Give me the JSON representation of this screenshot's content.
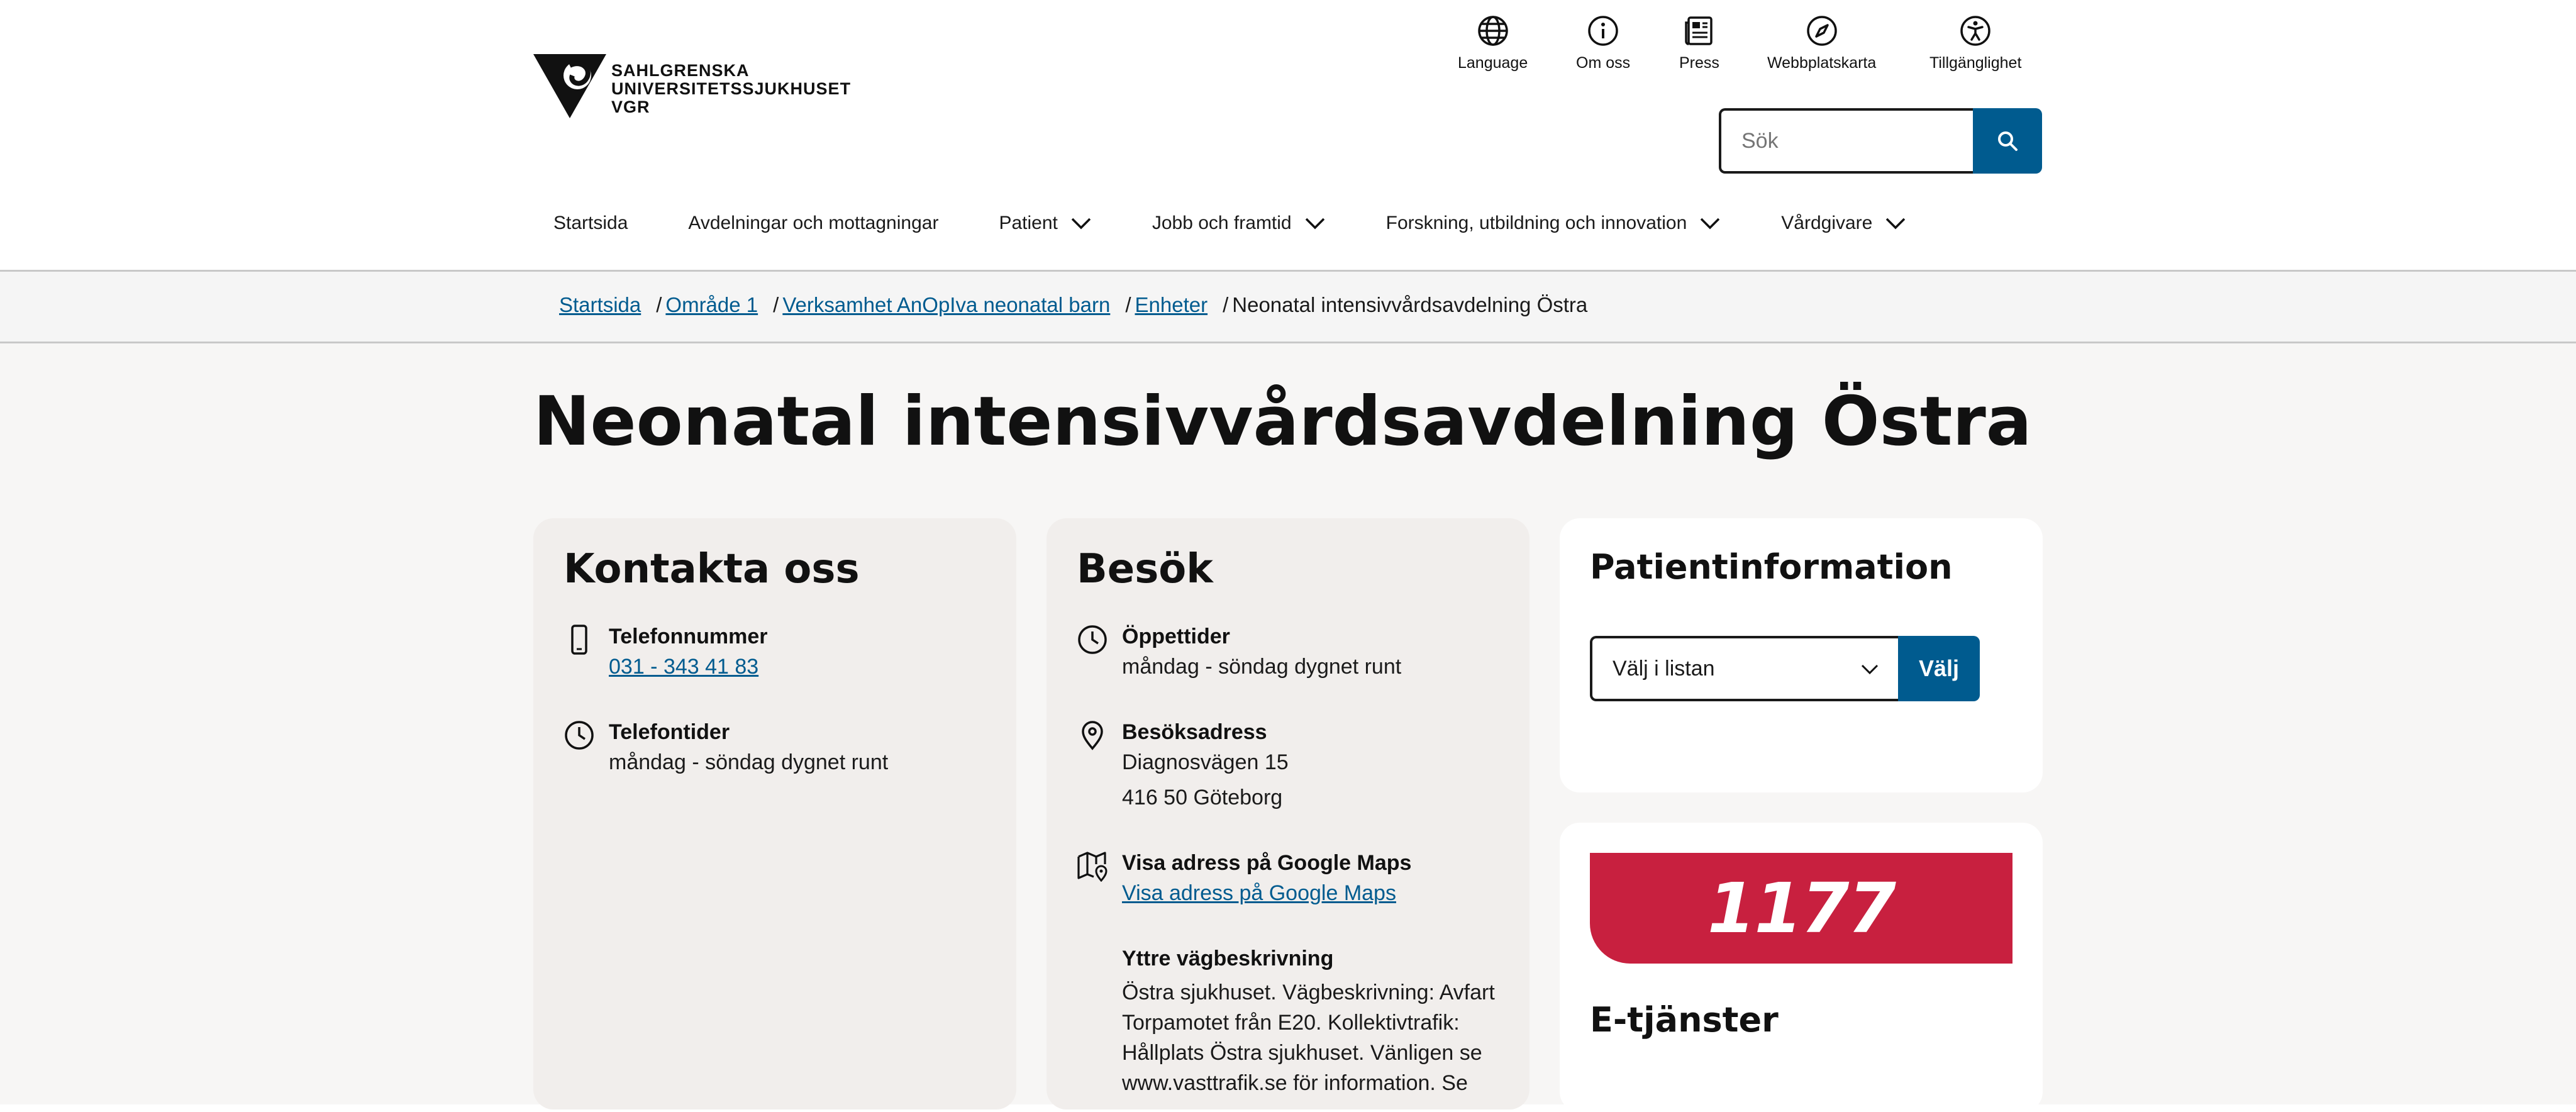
{
  "brand": {
    "logo_line1": "SAHLGRENSKA",
    "logo_line2": "UNIVERSITETSSJUKHUSET",
    "logo_line3": "VGR"
  },
  "utility_nav": [
    {
      "label": "Language",
      "icon": "globe-icon"
    },
    {
      "label": "Om oss",
      "icon": "info-icon"
    },
    {
      "label": "Press",
      "icon": "newspaper-icon"
    },
    {
      "label": "Webbplatskarta",
      "icon": "compass-icon"
    },
    {
      "label": "Tillgänglighet",
      "icon": "accessibility-icon"
    }
  ],
  "search": {
    "placeholder": "Sök",
    "icon": "search-icon"
  },
  "main_nav": [
    {
      "label": "Startsida",
      "has_dropdown": false
    },
    {
      "label": "Avdelningar och mottagningar",
      "has_dropdown": false
    },
    {
      "label": "Patient",
      "has_dropdown": true
    },
    {
      "label": "Jobb och framtid",
      "has_dropdown": true
    },
    {
      "label": "Forskning, utbildning och innovation",
      "has_dropdown": true
    },
    {
      "label": "Vårdgivare",
      "has_dropdown": true
    }
  ],
  "breadcrumb": {
    "links": [
      "Startsida",
      "Område 1",
      "Verksamhet AnOpIva neonatal barn",
      "Enheter"
    ],
    "current": "Neonatal intensivvårdsavdelning Östra"
  },
  "page": {
    "title": "Neonatal intensivvårdsavdelning Östra"
  },
  "contact": {
    "heading": "Kontakta oss",
    "phone_label": "Telefonnummer",
    "phone_value": "031 - 343 41 83",
    "phone_times_label": "Telefontider",
    "phone_times_value": "måndag - söndag dygnet runt"
  },
  "visit": {
    "heading": "Besök",
    "hours_label": "Öppettider",
    "hours_value": "måndag - söndag dygnet runt",
    "address_label": "Besöksadress",
    "address_line1": "Diagnosvägen 15",
    "address_line2": "416 50 Göteborg",
    "maps_label": "Visa adress på Google Maps",
    "maps_link": "Visa adress på Google Maps",
    "directions_label": "Yttre vägbeskrivning",
    "directions_lines": [
      "Östra sjukhuset. Vägbeskrivning: Avfart",
      "Torpamotet från E20. Kollektivtrafik:",
      "Hållplats Östra sjukhuset. Vänligen se",
      "www.vasttrafik.se för information. Se"
    ]
  },
  "patient_info": {
    "heading": "Patientinformation",
    "select_value": "Välj i listan",
    "button_label": "Välj"
  },
  "e_services": {
    "banner_text": "1177",
    "heading": "E-tjänster",
    "banner_color": "#c8203f"
  },
  "colors": {
    "accent": "#005b8f",
    "card_beige": "#f1eeec",
    "page_bg": "#f7f6f5"
  }
}
